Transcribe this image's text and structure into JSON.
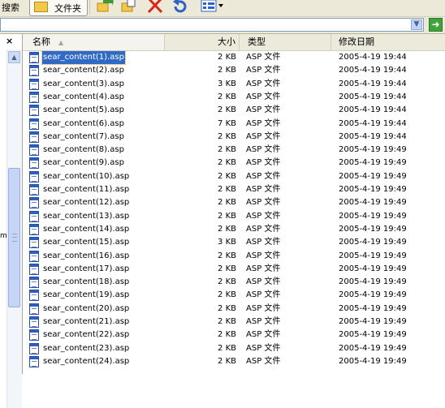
{
  "toolbar": {
    "search_label": "搜索",
    "folders_label": "文件夹",
    "icons": [
      "move-to-icon",
      "copy-to-icon",
      "delete-icon",
      "undo-icon",
      "views-icon"
    ]
  },
  "address": {
    "value": ""
  },
  "left_pane": {
    "close_glyph": "×",
    "fragment_text": "m:"
  },
  "columns": {
    "name": "名称",
    "size": "大小",
    "type": "类型",
    "date": "修改日期"
  },
  "colors": {
    "selection": "#316ac5",
    "header_bg": "#ebeadb",
    "toolbar_bg": "#ece9d8"
  },
  "files": [
    {
      "name": "sear_content(1).asp",
      "size": "2 KB",
      "type": "ASP 文件",
      "date": "2005-4-19 19:44"
    },
    {
      "name": "sear_content(2).asp",
      "size": "2 KB",
      "type": "ASP 文件",
      "date": "2005-4-19 19:44"
    },
    {
      "name": "sear_content(3).asp",
      "size": "3 KB",
      "type": "ASP 文件",
      "date": "2005-4-19 19:44"
    },
    {
      "name": "sear_content(4).asp",
      "size": "2 KB",
      "type": "ASP 文件",
      "date": "2005-4-19 19:44"
    },
    {
      "name": "sear_content(5).asp",
      "size": "2 KB",
      "type": "ASP 文件",
      "date": "2005-4-19 19:44"
    },
    {
      "name": "sear_content(6).asp",
      "size": "7 KB",
      "type": "ASP 文件",
      "date": "2005-4-19 19:44"
    },
    {
      "name": "sear_content(7).asp",
      "size": "2 KB",
      "type": "ASP 文件",
      "date": "2005-4-19 19:44"
    },
    {
      "name": "sear_content(8).asp",
      "size": "2 KB",
      "type": "ASP 文件",
      "date": "2005-4-19 19:49"
    },
    {
      "name": "sear_content(9).asp",
      "size": "2 KB",
      "type": "ASP 文件",
      "date": "2005-4-19 19:49"
    },
    {
      "name": "sear_content(10).asp",
      "size": "2 KB",
      "type": "ASP 文件",
      "date": "2005-4-19 19:49"
    },
    {
      "name": "sear_content(11).asp",
      "size": "2 KB",
      "type": "ASP 文件",
      "date": "2005-4-19 19:49"
    },
    {
      "name": "sear_content(12).asp",
      "size": "2 KB",
      "type": "ASP 文件",
      "date": "2005-4-19 19:49"
    },
    {
      "name": "sear_content(13).asp",
      "size": "2 KB",
      "type": "ASP 文件",
      "date": "2005-4-19 19:49"
    },
    {
      "name": "sear_content(14).asp",
      "size": "2 KB",
      "type": "ASP 文件",
      "date": "2005-4-19 19:49"
    },
    {
      "name": "sear_content(15).asp",
      "size": "3 KB",
      "type": "ASP 文件",
      "date": "2005-4-19 19:49"
    },
    {
      "name": "sear_content(16).asp",
      "size": "2 KB",
      "type": "ASP 文件",
      "date": "2005-4-19 19:49"
    },
    {
      "name": "sear_content(17).asp",
      "size": "2 KB",
      "type": "ASP 文件",
      "date": "2005-4-19 19:49"
    },
    {
      "name": "sear_content(18).asp",
      "size": "2 KB",
      "type": "ASP 文件",
      "date": "2005-4-19 19:49"
    },
    {
      "name": "sear_content(19).asp",
      "size": "2 KB",
      "type": "ASP 文件",
      "date": "2005-4-19 19:49"
    },
    {
      "name": "sear_content(20).asp",
      "size": "2 KB",
      "type": "ASP 文件",
      "date": "2005-4-19 19:49"
    },
    {
      "name": "sear_content(21).asp",
      "size": "2 KB",
      "type": "ASP 文件",
      "date": "2005-4-19 19:49"
    },
    {
      "name": "sear_content(22).asp",
      "size": "2 KB",
      "type": "ASP 文件",
      "date": "2005-4-19 19:49"
    },
    {
      "name": "sear_content(23).asp",
      "size": "2 KB",
      "type": "ASP 文件",
      "date": "2005-4-19 19:49"
    },
    {
      "name": "sear_content(24).asp",
      "size": "2 KB",
      "type": "ASP 文件",
      "date": "2005-4-19 19:49"
    }
  ]
}
